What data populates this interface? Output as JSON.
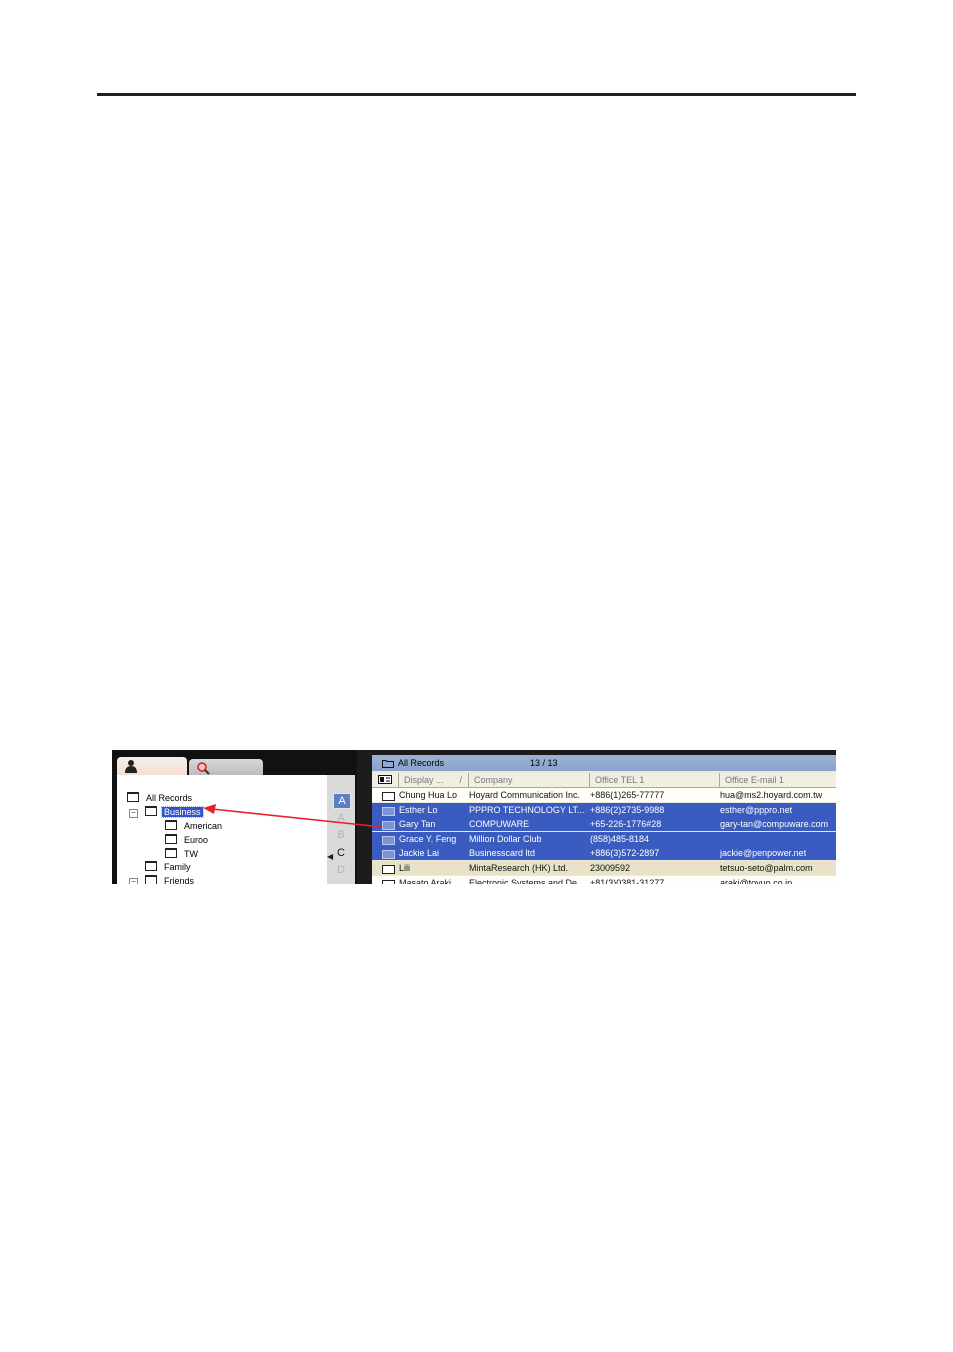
{
  "tree": {
    "items": [
      {
        "label": "All Records",
        "selected": false
      },
      {
        "label": "Business",
        "selected": true
      },
      {
        "label": "American",
        "selected": false
      },
      {
        "label": "Euroo",
        "selected": false
      },
      {
        "label": "TW",
        "selected": false
      },
      {
        "label": "Family",
        "selected": false
      },
      {
        "label": "Friends",
        "selected": false
      }
    ],
    "expand_symbol": "−"
  },
  "alphabet": [
    "A",
    "A",
    "B",
    "C",
    "D"
  ],
  "panel": {
    "title": "All Records",
    "count": "13 / 13"
  },
  "columns": [
    "Display ...",
    "Company",
    "Office TEL 1",
    "Office E-mail 1"
  ],
  "sort_marker": "/",
  "rows": [
    {
      "name": "Chung Hua Lo",
      "company": "Hoyard Communication Inc.",
      "tel": "+886(1)265-77777",
      "email": "hua@ms2.hoyard.com.tw",
      "state": "normal"
    },
    {
      "name": "Esther Lo",
      "company": "PPPRO TECHNOLOGY LT...",
      "tel": "+886(2)2735-9988",
      "email": "esther@pppro.net",
      "state": "selected"
    },
    {
      "name": "Gary Tan",
      "company": "COMPUWARE",
      "tel": "+65-226-1776#28",
      "email": "gary-tan@compuware.com",
      "state": "selected"
    },
    {
      "name": "Grace Y. Feng",
      "company": "Million Dollar Club",
      "tel": "(858)485-8184",
      "email": "",
      "state": "selected"
    },
    {
      "name": "Jackie Lai",
      "company": "Businesscard ltd",
      "tel": "+886(3)572-2897",
      "email": "jackie@penpower.net",
      "state": "selected"
    },
    {
      "name": "Lili",
      "company": "MintaResearch (HK) Ltd.",
      "tel": "23009592",
      "email": "tetsuo-seto@palm.com",
      "state": "tan"
    },
    {
      "name": "Masato Araki",
      "company": "Electronic Systems and De...",
      "tel": "+81(3)0381-31277",
      "email": "araki@toyuo.co.jp",
      "state": "normal"
    }
  ],
  "colors": {
    "selection": "#3a5bc0",
    "arrow": "#e8202a",
    "accent": "#5b7fc4"
  }
}
